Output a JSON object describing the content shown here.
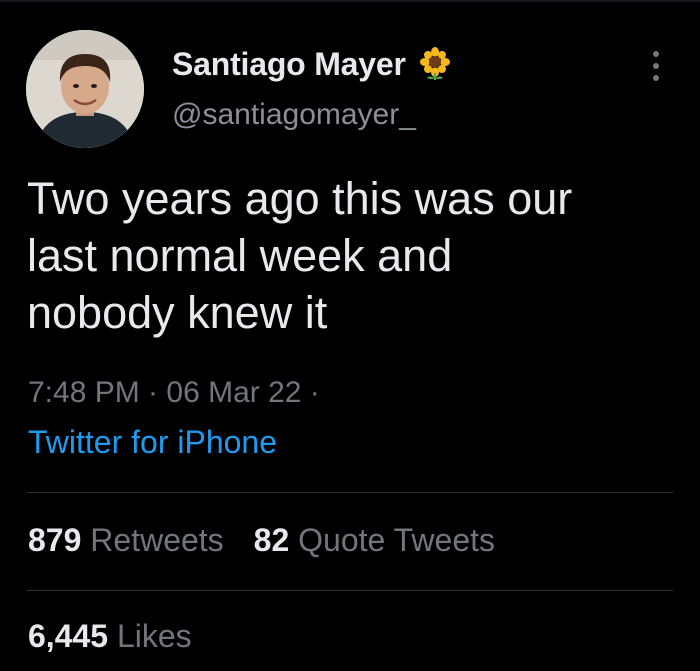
{
  "author": {
    "display_name": "Santiago Mayer",
    "handle": "@santiagomayer_",
    "badge_icon": "sunflower-icon",
    "avatar": "avatar-photo"
  },
  "tweet": {
    "text": "Two years ago this was our\nlast normal week and\nnobody knew it",
    "meta": "7:48 PM · 06 Mar 22 ·",
    "source": "Twitter for iPhone"
  },
  "stats": {
    "retweets_count": "879",
    "retweets_label": "Retweets",
    "quote_count": "82",
    "quote_label": "Quote Tweets",
    "likes_count": "6,445",
    "likes_label": "Likes"
  },
  "icons": {
    "more": "more-vertical-icon"
  },
  "colors": {
    "background": "#000000",
    "text_primary": "#e7e9ea",
    "text_secondary": "#71767b",
    "link": "#1d9bf0",
    "divider": "#2f3336"
  }
}
